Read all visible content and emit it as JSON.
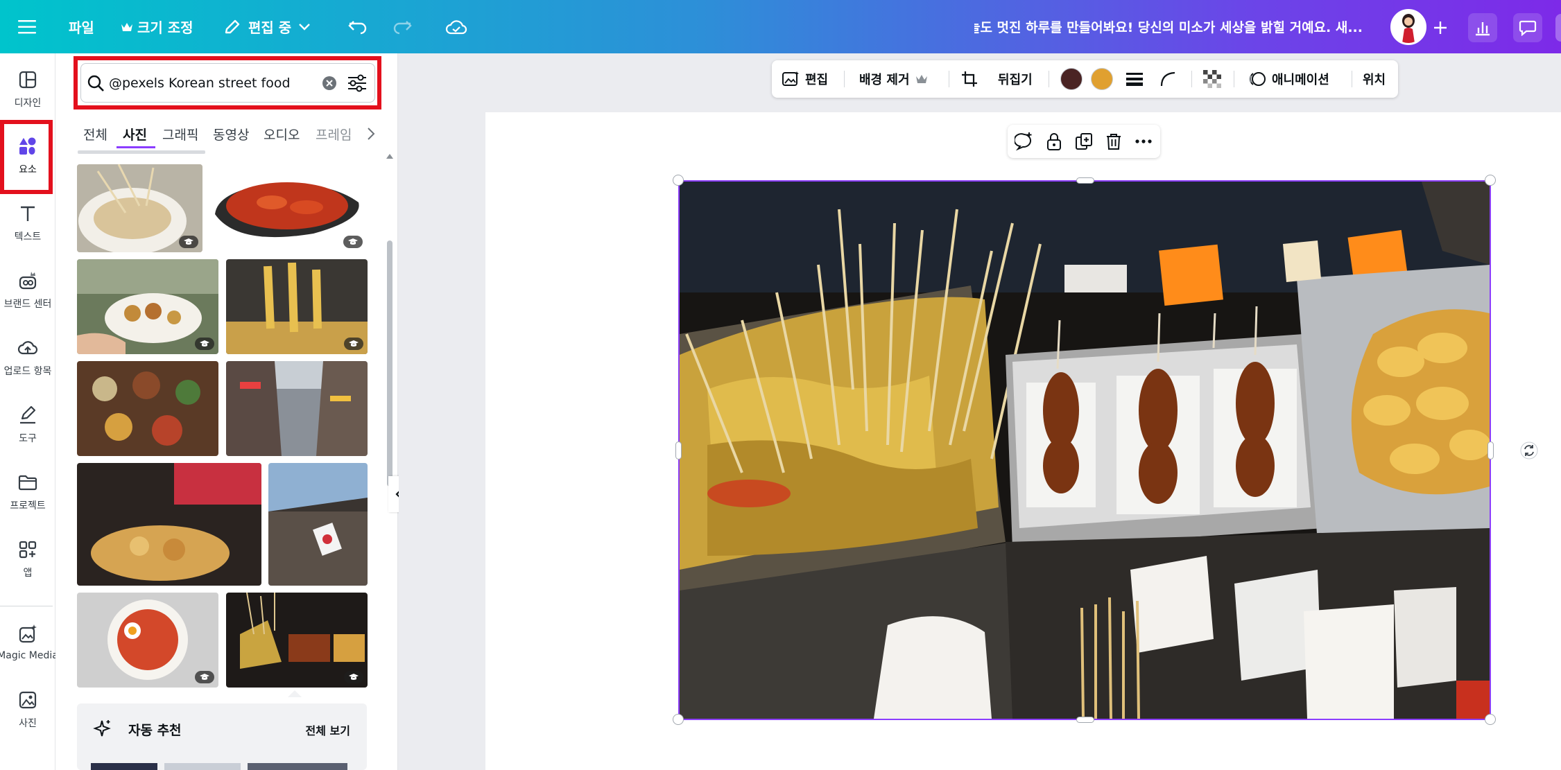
{
  "topbar": {
    "file_label": "파일",
    "resize_label": "크기 조정",
    "editing_label": "편집 중",
    "title": "오늘도 멋진 하루를 만들어봐요! 당신의 미소가 세상을 밝힐 거예요. 새...",
    "gradient_start": "#00c4cc",
    "gradient_end": "#7d2ae8",
    "icons": [
      "menu-icon",
      "crown-icon",
      "pencil-icon",
      "chevron-down-icon",
      "undo-icon",
      "redo-icon",
      "cloud-check-icon",
      "plus-icon",
      "bar-chart-icon",
      "comment-icon"
    ]
  },
  "rail": {
    "items": [
      {
        "label": "디자인",
        "icon": "layout-icon"
      },
      {
        "label": "요소",
        "icon": "elements-icon"
      },
      {
        "label": "텍스트",
        "icon": "text-icon"
      },
      {
        "label": "브랜드 센터",
        "icon": "brand-icon"
      },
      {
        "label": "업로드 항목",
        "icon": "upload-icon"
      },
      {
        "label": "도구",
        "icon": "draw-icon"
      },
      {
        "label": "프로젝트",
        "icon": "folder-icon"
      },
      {
        "label": "앱",
        "icon": "apps-icon"
      },
      {
        "label": "Magic Media",
        "icon": "magic-media-icon"
      },
      {
        "label": "사진",
        "icon": "photo-icon"
      }
    ],
    "active_index": 1,
    "highlight_color": "#e3101d"
  },
  "panel": {
    "search_value": "@pexels Korean street food",
    "tabs": [
      "전체",
      "사진",
      "그래픽",
      "동영상",
      "오디오",
      "프레임"
    ],
    "active_tab": "사진",
    "accent": "#8b3dff",
    "auto_section": {
      "title": "자동 추천",
      "see_all": "전체 보기"
    }
  },
  "toolbar": {
    "edit_label": "편집",
    "bg_remove_label": "배경 제거",
    "flip_label": "뒤집기",
    "animate_label": "애니메이션",
    "position_label": "위치",
    "color_1": "#4a2424",
    "color_2": "#e0a030"
  }
}
